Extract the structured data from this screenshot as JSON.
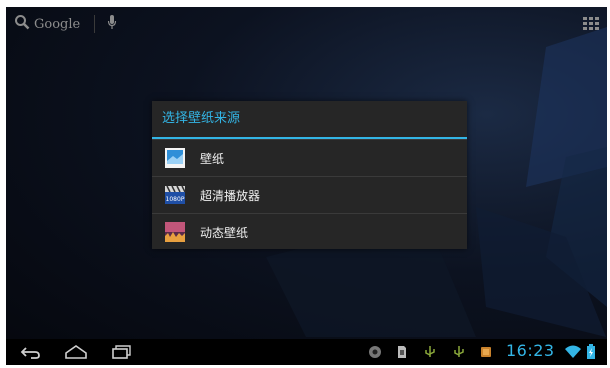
{
  "search": {
    "label": "Google"
  },
  "dialog": {
    "title": "选择壁纸来源",
    "options": [
      {
        "label": "壁纸",
        "icon": "wallpaper-icon"
      },
      {
        "label": "超清播放器",
        "icon": "hd-player-icon"
      },
      {
        "label": "动态壁纸",
        "icon": "live-wallpaper-icon"
      }
    ]
  },
  "status_bar": {
    "time": "16:23"
  },
  "colors": {
    "accent": "#33b5e5",
    "dialog_bg": "#262626",
    "text": "#f0f0f0"
  }
}
